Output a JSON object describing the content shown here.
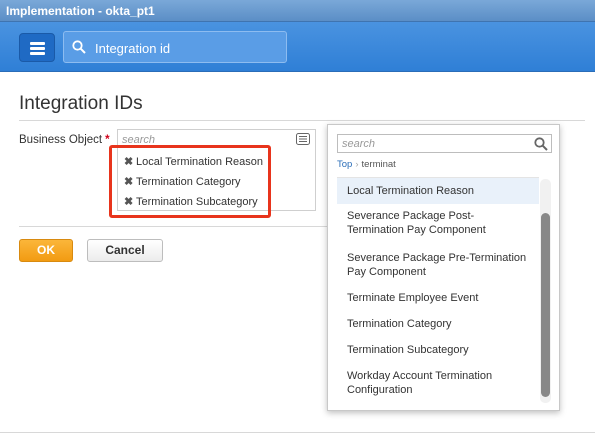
{
  "window": {
    "title": "Implementation - okta_pt1"
  },
  "header": {
    "search_text": "Integration id"
  },
  "page": {
    "title": "Integration IDs"
  },
  "form": {
    "business_object_label": "Business Object",
    "required_marker": "*",
    "prompt_placeholder": "search",
    "selected": [
      "Local Termination Reason",
      "Termination Category",
      "Termination Subcategory"
    ],
    "remove_glyph": "✖"
  },
  "buttons": {
    "ok": "OK",
    "cancel": "Cancel"
  },
  "dropdown": {
    "search_placeholder": "search",
    "breadcrumb_top": "Top",
    "breadcrumb_sep": "›",
    "breadcrumb_current": "terminat",
    "items": [
      {
        "label": "Local Termination Reason",
        "lines": [
          "Local Termination Reason"
        ]
      },
      {
        "label": "Severance Package Post-Termination Pay Component",
        "lines": [
          "Severance Package Post-",
          "Termination Pay Component"
        ]
      },
      {
        "label": "Severance Package Pre-Termination Pay Component",
        "lines": [
          "Severance Package Pre-Termination",
          "Pay Component"
        ]
      },
      {
        "label": "Terminate Employee Event",
        "lines": [
          "Terminate Employee Event"
        ]
      },
      {
        "label": "Termination Category",
        "lines": [
          "Termination Category"
        ]
      },
      {
        "label": "Termination Subcategory",
        "lines": [
          "Termination Subcategory"
        ]
      },
      {
        "label": "Workday Account Termination Configuration",
        "lines": [
          "Workday Account Termination",
          "Configuration"
        ]
      }
    ]
  },
  "colors": {
    "accent_blue": "#2f7fd6",
    "ok_orange": "#f29b12",
    "highlight_red": "#e8341c",
    "required_red": "#d0021b"
  },
  "icons": [
    "menu-icon",
    "search-icon",
    "prompt-list-icon",
    "remove-icon"
  ]
}
